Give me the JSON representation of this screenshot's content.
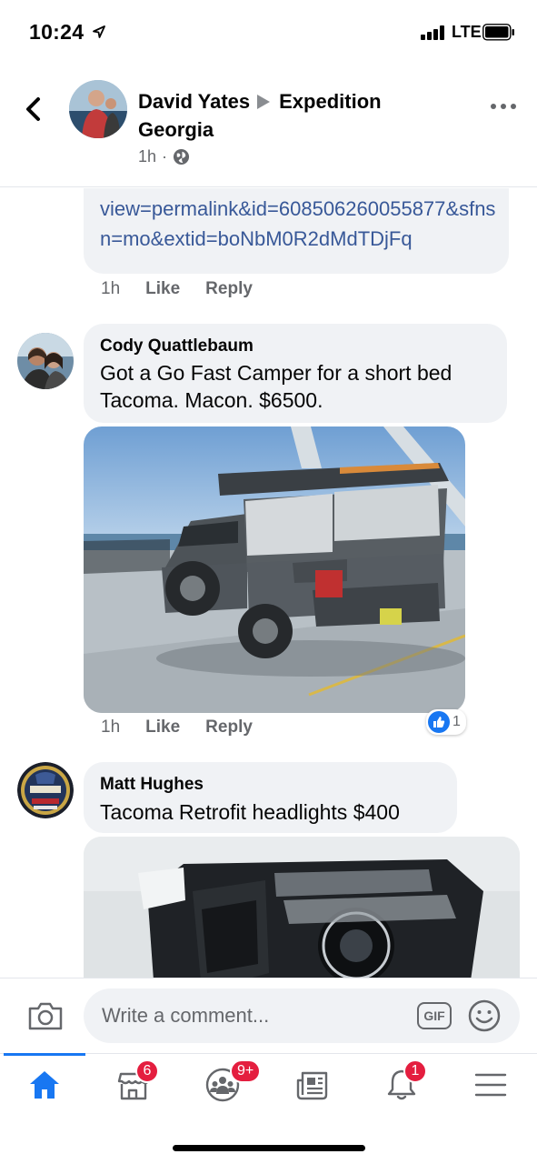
{
  "status_bar": {
    "time": "10:24",
    "network": "LTE"
  },
  "header": {
    "author": "David Yates",
    "group": "Expedition Georgia",
    "time": "1h"
  },
  "link_comment": {
    "link_text": "view=permalink&id=608506260055877&sfnsn=mo&extid=boNbM0R2dMdTDjFq",
    "actions": {
      "time": "1h",
      "like": "Like",
      "reply": "Reply"
    }
  },
  "comments": [
    {
      "name": "Cody Quattlebaum",
      "text_line1": "Got a Go Fast Camper for a short bed",
      "text_line2": "Tacoma. Macon. $6500.",
      "actions": {
        "time": "1h",
        "like": "Like",
        "reply": "Reply"
      },
      "reaction_count": "1",
      "photo_subject": "Gray pickup truck with pop-up camper on ferry deck"
    },
    {
      "name": "Matt Hughes",
      "text": "Tacoma Retrofit headlights $400",
      "photo_subject": "Headlight assembly"
    }
  ],
  "composer": {
    "placeholder": "Write a comment...",
    "gif_label": "GIF"
  },
  "tab_bar": {
    "items": [
      {
        "name": "home",
        "icon": "home-icon",
        "badge": ""
      },
      {
        "name": "marketplace",
        "icon": "marketplace-icon",
        "badge": "6"
      },
      {
        "name": "groups",
        "icon": "groups-icon",
        "badge": "9+"
      },
      {
        "name": "news",
        "icon": "news-icon",
        "badge": ""
      },
      {
        "name": "notifications",
        "icon": "bell-icon",
        "badge": "1"
      },
      {
        "name": "menu",
        "icon": "menu-icon",
        "badge": ""
      }
    ]
  },
  "colors": {
    "accent": "#1877f2",
    "link": "#385898",
    "badge": "#e41e3f",
    "bubble": "#f0f2f5"
  }
}
